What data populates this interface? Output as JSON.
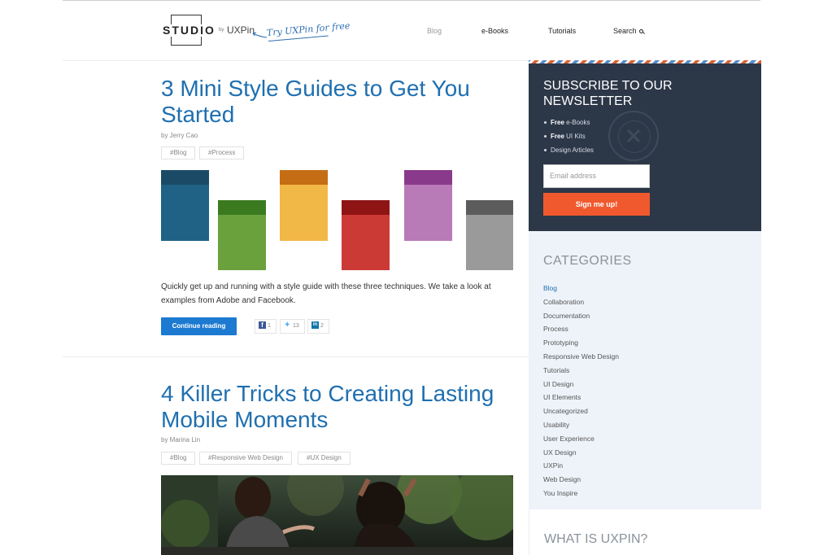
{
  "header": {
    "logo": "STUDIO",
    "by": "by",
    "brand": "UXPin",
    "try_link": "Try UXPin for free",
    "nav": [
      {
        "label": "Blog",
        "active": true
      },
      {
        "label": "e-Books",
        "active": false
      },
      {
        "label": "Tutorials",
        "active": false
      },
      {
        "label": "Search",
        "active": false
      }
    ]
  },
  "posts": [
    {
      "title": "3 Mini Style Guides to Get You Started",
      "author": "by Jerry Cao",
      "tags": [
        "#Blog",
        "#Process"
      ],
      "excerpt": "Quickly get up and running with a style guide with these three techniques. We take a look at examples from Adobe and Facebook.",
      "continue_label": "Continue reading",
      "shares": {
        "facebook": "1",
        "twitter": "13",
        "linkedin": "2"
      },
      "swatches": [
        {
          "cap": "#1b4a66",
          "body": "#1f6285"
        },
        {
          "cap": "#3c7a20",
          "body": "#6aa13c"
        },
        {
          "cap": "#c46d14",
          "body": "#f2b847"
        },
        {
          "cap": "#8f1515",
          "body": "#cc3a36"
        },
        {
          "cap": "#8a3a8a",
          "body": "#b97ab8"
        },
        {
          "cap": "#5c5c5c",
          "body": "#9a9a9a"
        }
      ]
    },
    {
      "title": "4 Killer Tricks to Creating Lasting Mobile Moments",
      "author": "by Marina Lin",
      "tags": [
        "#Blog",
        "#Responsive Web Design",
        "#UX Design"
      ]
    }
  ],
  "sidebar": {
    "newsletter": {
      "title": "Subscribe to our newsletter",
      "items": [
        {
          "strong": "Free",
          "rest": " e-Books"
        },
        {
          "strong": "Free",
          "rest": " UI Kits"
        },
        {
          "strong": "",
          "rest": "Design Articles"
        }
      ],
      "email_placeholder": "Email address",
      "button": "Sign me up!"
    },
    "categories": {
      "heading": "Categories",
      "items": [
        "Blog",
        "Collaboration",
        "Documentation",
        "Process",
        "Prototyping",
        "Responsive Web Design",
        "Tutorials",
        "UI Design",
        "UI Elements",
        "Uncategorized",
        "Usability",
        "User Experience",
        "UX Design",
        "UXPin",
        "Web Design",
        "You Inspire"
      ],
      "active": "Blog"
    },
    "whatis": {
      "heading": "What is UXPin?"
    }
  },
  "colors": {
    "link_blue": "#1f6fb0",
    "button_blue": "#1d7ad1",
    "newsletter_bg": "#2c3748",
    "cta_orange": "#f0592e",
    "sidebar_bg": "#eef3f9"
  }
}
